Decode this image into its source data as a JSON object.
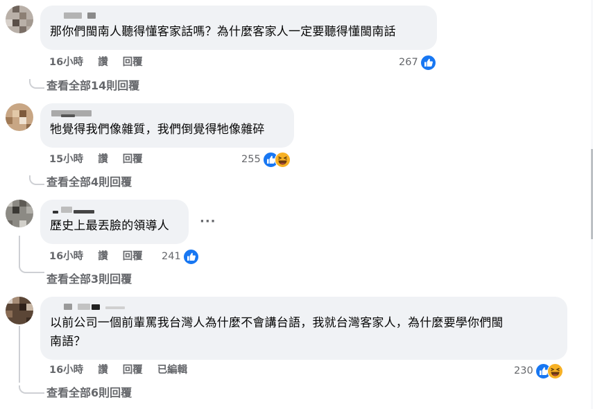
{
  "comments": [
    {
      "text": "那你們閩南人聽得懂客家話嗎？為什麼客家人一定要聽得懂閩南話",
      "time": "16小時",
      "like_label": "讚",
      "reply_label": "回覆",
      "edited_label": "",
      "reaction_count": "267",
      "reactions": [
        "like-icon"
      ],
      "view_replies": "查看全部14則回覆"
    },
    {
      "text": "牠覺得我們像雜質，我們倒覺得牠像雜碎",
      "time": "15小時",
      "like_label": "讚",
      "reply_label": "回覆",
      "edited_label": "",
      "reaction_count": "255",
      "reactions": [
        "like-icon",
        "haha-icon"
      ],
      "view_replies": "查看全部4則回覆"
    },
    {
      "text": "歷史上最丟臉的領導人",
      "time": "16小時",
      "like_label": "讚",
      "reply_label": "回覆",
      "edited_label": "",
      "reaction_count": "241",
      "reactions": [
        "like-icon"
      ],
      "view_replies": "查看全部3則回覆",
      "more_options": "···"
    },
    {
      "text_line1": "以前公司一個前輩罵我台灣人為什麼不會講台語，我就台灣客家人，為什麼要學你們閩",
      "text_line2": "南語？",
      "time": "16小時",
      "like_label": "讚",
      "reply_label": "回覆",
      "edited_label": "已編輯",
      "reaction_count": "230",
      "reactions": [
        "like-icon",
        "haha-icon"
      ],
      "view_replies": "查看全部6則回覆"
    }
  ],
  "colors": {
    "bubble": "#f0f2f5",
    "secondary_text": "#65676b",
    "like_blue": "#1877f2",
    "haha_yellow": "#f7b125"
  }
}
